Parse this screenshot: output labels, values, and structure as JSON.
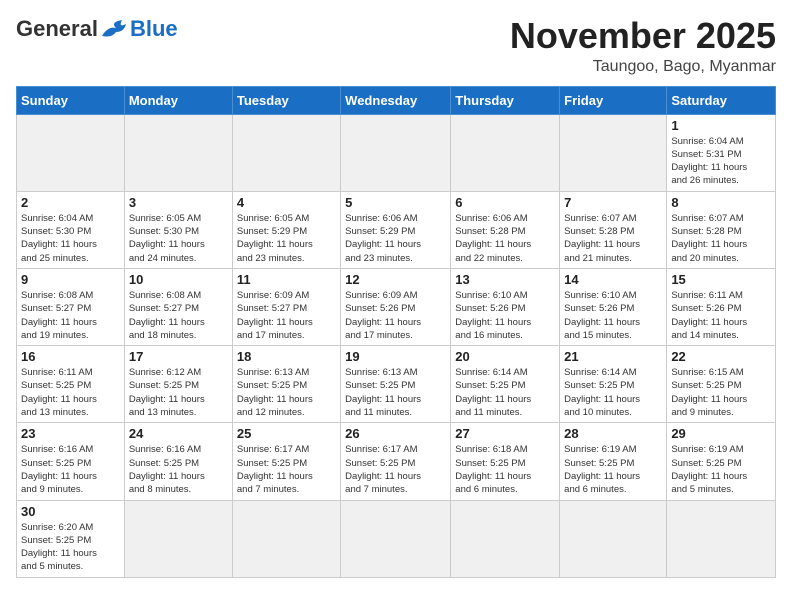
{
  "header": {
    "logo_general": "General",
    "logo_blue": "Blue",
    "month_year": "November 2025",
    "location": "Taungoo, Bago, Myanmar"
  },
  "days_of_week": [
    "Sunday",
    "Monday",
    "Tuesday",
    "Wednesday",
    "Thursday",
    "Friday",
    "Saturday"
  ],
  "weeks": [
    [
      {
        "day": "",
        "info": ""
      },
      {
        "day": "",
        "info": ""
      },
      {
        "day": "",
        "info": ""
      },
      {
        "day": "",
        "info": ""
      },
      {
        "day": "",
        "info": ""
      },
      {
        "day": "",
        "info": ""
      },
      {
        "day": "1",
        "info": "Sunrise: 6:04 AM\nSunset: 5:31 PM\nDaylight: 11 hours\nand 26 minutes."
      }
    ],
    [
      {
        "day": "2",
        "info": "Sunrise: 6:04 AM\nSunset: 5:30 PM\nDaylight: 11 hours\nand 25 minutes."
      },
      {
        "day": "3",
        "info": "Sunrise: 6:05 AM\nSunset: 5:30 PM\nDaylight: 11 hours\nand 24 minutes."
      },
      {
        "day": "4",
        "info": "Sunrise: 6:05 AM\nSunset: 5:29 PM\nDaylight: 11 hours\nand 23 minutes."
      },
      {
        "day": "5",
        "info": "Sunrise: 6:06 AM\nSunset: 5:29 PM\nDaylight: 11 hours\nand 23 minutes."
      },
      {
        "day": "6",
        "info": "Sunrise: 6:06 AM\nSunset: 5:28 PM\nDaylight: 11 hours\nand 22 minutes."
      },
      {
        "day": "7",
        "info": "Sunrise: 6:07 AM\nSunset: 5:28 PM\nDaylight: 11 hours\nand 21 minutes."
      },
      {
        "day": "8",
        "info": "Sunrise: 6:07 AM\nSunset: 5:28 PM\nDaylight: 11 hours\nand 20 minutes."
      }
    ],
    [
      {
        "day": "9",
        "info": "Sunrise: 6:08 AM\nSunset: 5:27 PM\nDaylight: 11 hours\nand 19 minutes."
      },
      {
        "day": "10",
        "info": "Sunrise: 6:08 AM\nSunset: 5:27 PM\nDaylight: 11 hours\nand 18 minutes."
      },
      {
        "day": "11",
        "info": "Sunrise: 6:09 AM\nSunset: 5:27 PM\nDaylight: 11 hours\nand 17 minutes."
      },
      {
        "day": "12",
        "info": "Sunrise: 6:09 AM\nSunset: 5:26 PM\nDaylight: 11 hours\nand 17 minutes."
      },
      {
        "day": "13",
        "info": "Sunrise: 6:10 AM\nSunset: 5:26 PM\nDaylight: 11 hours\nand 16 minutes."
      },
      {
        "day": "14",
        "info": "Sunrise: 6:10 AM\nSunset: 5:26 PM\nDaylight: 11 hours\nand 15 minutes."
      },
      {
        "day": "15",
        "info": "Sunrise: 6:11 AM\nSunset: 5:26 PM\nDaylight: 11 hours\nand 14 minutes."
      }
    ],
    [
      {
        "day": "16",
        "info": "Sunrise: 6:11 AM\nSunset: 5:25 PM\nDaylight: 11 hours\nand 13 minutes."
      },
      {
        "day": "17",
        "info": "Sunrise: 6:12 AM\nSunset: 5:25 PM\nDaylight: 11 hours\nand 13 minutes."
      },
      {
        "day": "18",
        "info": "Sunrise: 6:13 AM\nSunset: 5:25 PM\nDaylight: 11 hours\nand 12 minutes."
      },
      {
        "day": "19",
        "info": "Sunrise: 6:13 AM\nSunset: 5:25 PM\nDaylight: 11 hours\nand 11 minutes."
      },
      {
        "day": "20",
        "info": "Sunrise: 6:14 AM\nSunset: 5:25 PM\nDaylight: 11 hours\nand 11 minutes."
      },
      {
        "day": "21",
        "info": "Sunrise: 6:14 AM\nSunset: 5:25 PM\nDaylight: 11 hours\nand 10 minutes."
      },
      {
        "day": "22",
        "info": "Sunrise: 6:15 AM\nSunset: 5:25 PM\nDaylight: 11 hours\nand 9 minutes."
      }
    ],
    [
      {
        "day": "23",
        "info": "Sunrise: 6:16 AM\nSunset: 5:25 PM\nDaylight: 11 hours\nand 9 minutes."
      },
      {
        "day": "24",
        "info": "Sunrise: 6:16 AM\nSunset: 5:25 PM\nDaylight: 11 hours\nand 8 minutes."
      },
      {
        "day": "25",
        "info": "Sunrise: 6:17 AM\nSunset: 5:25 PM\nDaylight: 11 hours\nand 7 minutes."
      },
      {
        "day": "26",
        "info": "Sunrise: 6:17 AM\nSunset: 5:25 PM\nDaylight: 11 hours\nand 7 minutes."
      },
      {
        "day": "27",
        "info": "Sunrise: 6:18 AM\nSunset: 5:25 PM\nDaylight: 11 hours\nand 6 minutes."
      },
      {
        "day": "28",
        "info": "Sunrise: 6:19 AM\nSunset: 5:25 PM\nDaylight: 11 hours\nand 6 minutes."
      },
      {
        "day": "29",
        "info": "Sunrise: 6:19 AM\nSunset: 5:25 PM\nDaylight: 11 hours\nand 5 minutes."
      }
    ],
    [
      {
        "day": "30",
        "info": "Sunrise: 6:20 AM\nSunset: 5:25 PM\nDaylight: 11 hours\nand 5 minutes."
      },
      {
        "day": "",
        "info": ""
      },
      {
        "day": "",
        "info": ""
      },
      {
        "day": "",
        "info": ""
      },
      {
        "day": "",
        "info": ""
      },
      {
        "day": "",
        "info": ""
      },
      {
        "day": "",
        "info": ""
      }
    ]
  ]
}
